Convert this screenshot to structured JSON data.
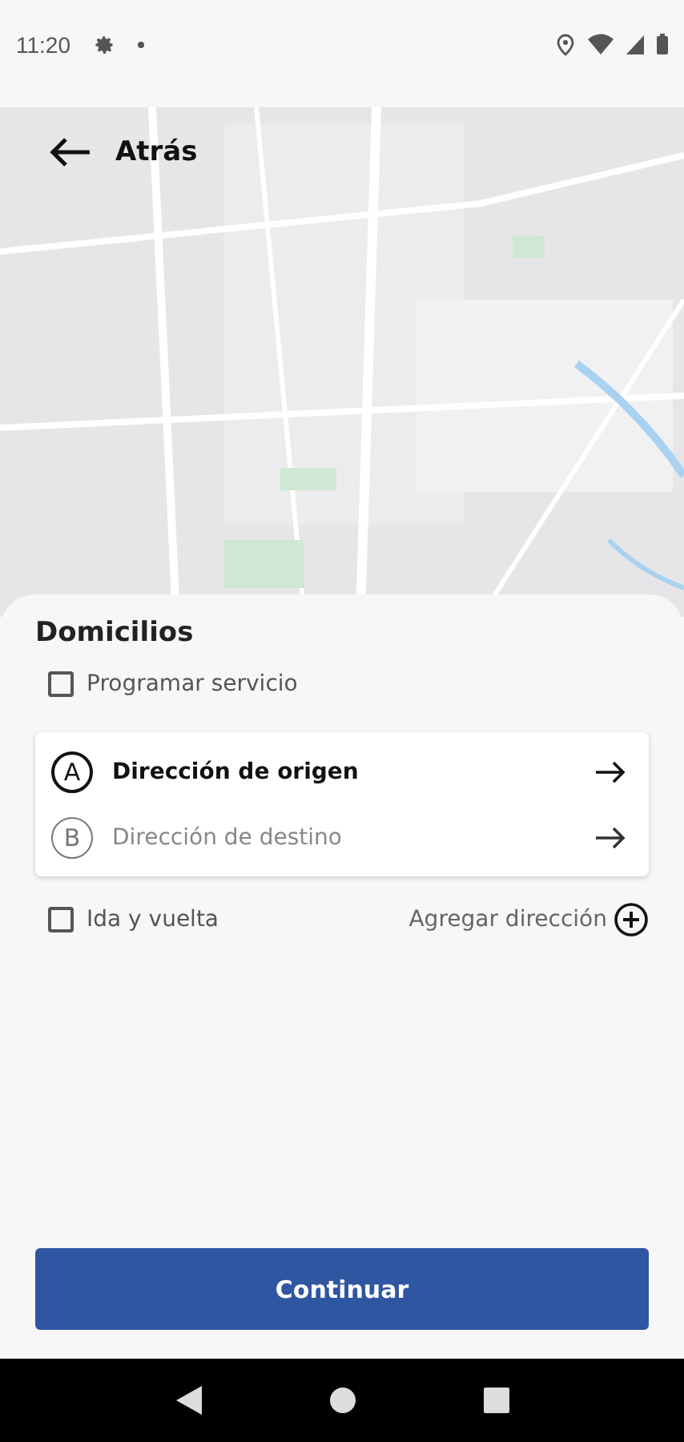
{
  "status_bar": {
    "time": "11:20"
  },
  "map": {
    "kind": "picture",
    "back_label": "Atrás"
  },
  "sheet": {
    "title": "Domicilios",
    "schedule": {
      "label": "Programar servicio",
      "checked": false
    },
    "addresses": [
      {
        "letter": "A",
        "label": "Dirección de origen",
        "selected": true
      },
      {
        "letter": "B",
        "label": "Dirección de destino",
        "selected": false
      }
    ],
    "round_trip": {
      "label": "Ida y vuelta",
      "checked": false
    },
    "add_address": "Agregar dirección",
    "continue": "Continuar"
  }
}
